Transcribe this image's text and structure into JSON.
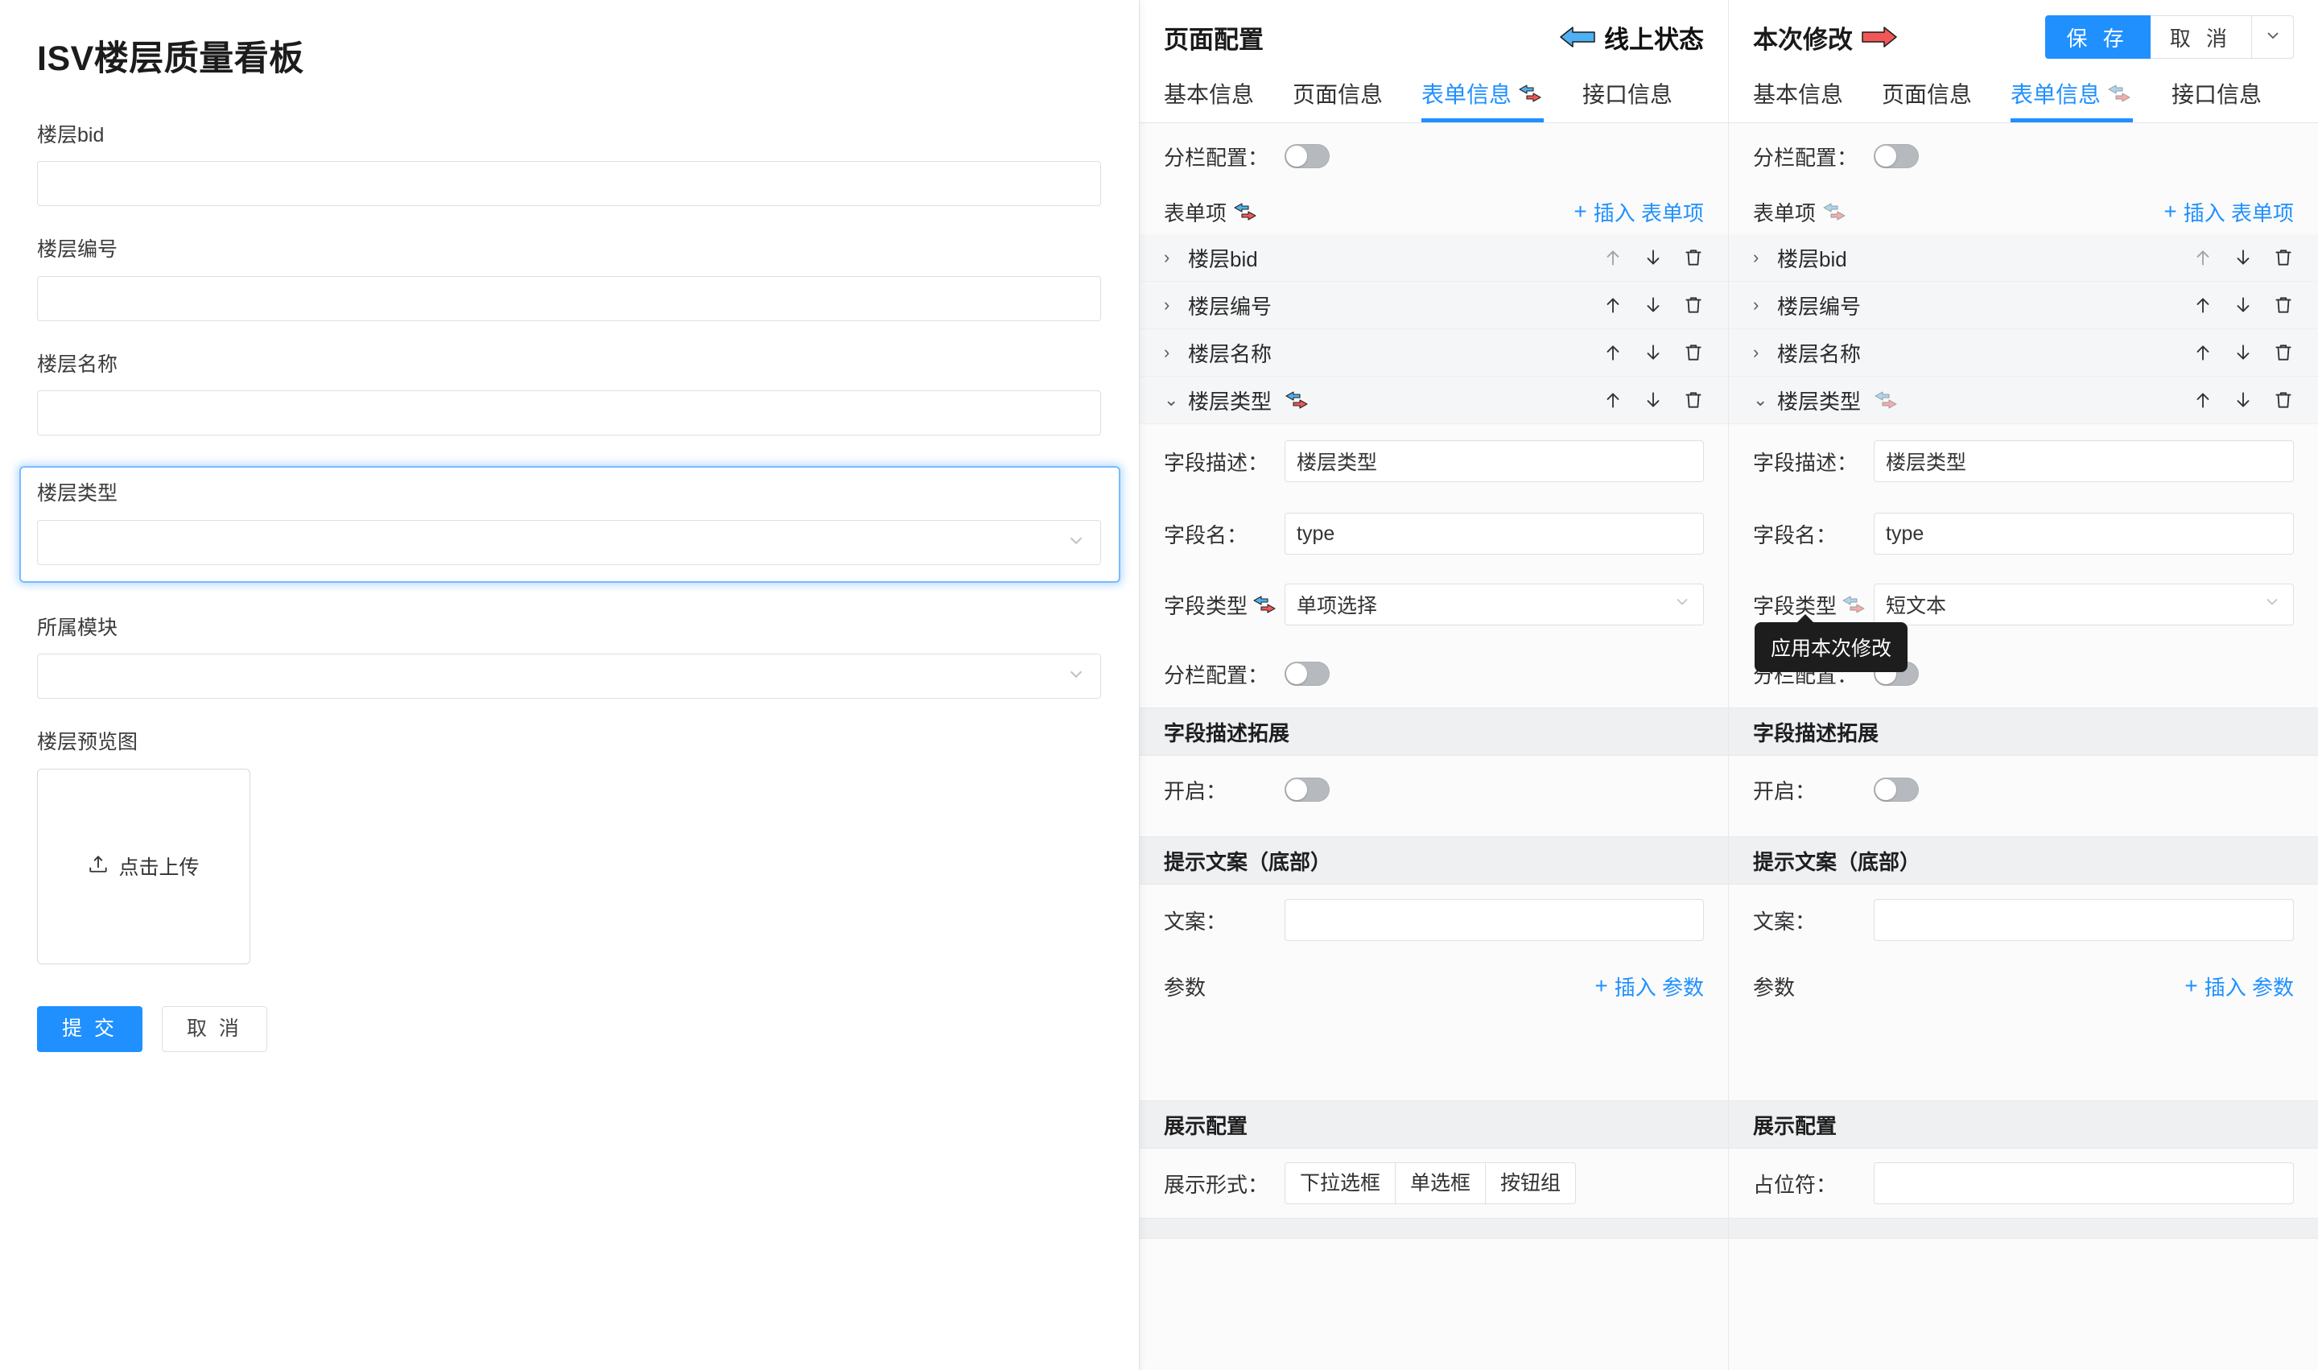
{
  "preview": {
    "title": "ISV楼层质量看板",
    "fields": [
      {
        "label": "楼层bid",
        "type": "text",
        "value": "",
        "placeholder": ""
      },
      {
        "label": "楼层编号",
        "type": "text",
        "value": "",
        "placeholder": ""
      },
      {
        "label": "楼层名称",
        "type": "text",
        "value": "",
        "placeholder": ""
      },
      {
        "label": "楼层类型",
        "type": "select",
        "value": "",
        "placeholder": "",
        "focused": true
      },
      {
        "label": "所属模块",
        "type": "select",
        "value": "",
        "placeholder": ""
      }
    ],
    "upload": {
      "label": "楼层预览图",
      "button_text": "点击上传",
      "icon": "upload-icon"
    },
    "submit_label": "提 交",
    "cancel_label": "取 消"
  },
  "middle": {
    "title": "页面配置",
    "status_badge": {
      "label": "线上状态",
      "icon": "arrow-left-blue-icon"
    },
    "tabs": [
      {
        "label": "基本信息",
        "active": false
      },
      {
        "label": "页面信息",
        "active": false
      },
      {
        "label": "表单信息",
        "active": true,
        "icon": "swap-arrows-icon"
      },
      {
        "label": "接口信息",
        "active": false
      }
    ],
    "column_config": {
      "label": "分栏配置：",
      "enabled": false
    },
    "form_items": {
      "title": "表单项",
      "title_icon": "swap-arrows-icon",
      "insert_label": "插入 表单项",
      "insert_icon": "plus-icon",
      "rows": [
        {
          "label": "楼层bid",
          "expanded": false,
          "up_disabled": true,
          "icons": [
            "arrow-up-icon",
            "arrow-down-icon",
            "trash-icon"
          ]
        },
        {
          "label": "楼层编号",
          "expanded": false,
          "up_disabled": false,
          "icons": [
            "arrow-up-icon",
            "arrow-down-icon",
            "trash-icon"
          ]
        },
        {
          "label": "楼层名称",
          "expanded": false,
          "up_disabled": false,
          "icons": [
            "arrow-up-icon",
            "arrow-down-icon",
            "trash-icon"
          ]
        },
        {
          "label": "楼层类型",
          "expanded": true,
          "up_disabled": false,
          "has_icon": true,
          "icons": [
            "arrow-up-icon",
            "arrow-down-icon",
            "trash-icon"
          ]
        }
      ]
    },
    "field_detail": {
      "desc_label": "字段描述：",
      "desc_value": "楼层类型",
      "name_label": "字段名：",
      "name_value": "type",
      "type_label": "字段类型",
      "type_icon": "swap-arrows-icon",
      "type_value": "单项选择",
      "column_label": "分栏配置：",
      "column_enabled": false
    },
    "desc_ext": {
      "title": "字段描述拓展",
      "enable_label": "开启：",
      "enabled": false
    },
    "hint_text": {
      "title": "提示文案（底部）",
      "copy_label": "文案：",
      "copy_value": ""
    },
    "params": {
      "title": "参数",
      "insert_label": "插入 参数",
      "insert_icon": "plus-icon"
    },
    "display_config": {
      "title": "展示配置",
      "form_label": "展示形式：",
      "options": [
        "下拉选框",
        "单选框",
        "按钮组"
      ]
    }
  },
  "right": {
    "title": "本次修改",
    "title_icon": "arrow-right-red-icon",
    "actions": {
      "save_label": "保 存",
      "cancel_label": "取 消",
      "dropdown_icon": "chevron-down-icon"
    },
    "tabs": [
      {
        "label": "基本信息",
        "active": false
      },
      {
        "label": "页面信息",
        "active": false
      },
      {
        "label": "表单信息",
        "active": true,
        "icon": "swap-arrows-icon"
      },
      {
        "label": "接口信息",
        "active": false
      }
    ],
    "column_config": {
      "label": "分栏配置：",
      "enabled": false
    },
    "form_items": {
      "title": "表单项",
      "title_icon": "swap-arrows-icon",
      "insert_label": "插入 表单项",
      "insert_icon": "plus-icon",
      "rows": [
        {
          "label": "楼层bid",
          "expanded": false,
          "up_disabled": true,
          "icons": [
            "arrow-up-icon",
            "arrow-down-icon",
            "trash-icon"
          ]
        },
        {
          "label": "楼层编号",
          "expanded": false,
          "up_disabled": false,
          "icons": [
            "arrow-up-icon",
            "arrow-down-icon",
            "trash-icon"
          ]
        },
        {
          "label": "楼层名称",
          "expanded": false,
          "up_disabled": false,
          "icons": [
            "arrow-up-icon",
            "arrow-down-icon",
            "trash-icon"
          ]
        },
        {
          "label": "楼层类型",
          "expanded": true,
          "up_disabled": false,
          "has_icon": true,
          "icons": [
            "arrow-up-icon",
            "arrow-down-icon",
            "trash-icon"
          ]
        }
      ]
    },
    "field_detail": {
      "desc_label": "字段描述：",
      "desc_value": "楼层类型",
      "name_label": "字段名：",
      "name_value": "type",
      "type_label": "字段类型",
      "type_icon": "swap-arrows-icon",
      "type_value": "短文本",
      "column_label": "分栏配置：",
      "column_enabled": false
    },
    "tooltip": "应用本次修改",
    "desc_ext": {
      "title": "字段描述拓展",
      "enable_label": "开启：",
      "enabled": false
    },
    "hint_text": {
      "title": "提示文案（底部）",
      "copy_label": "文案：",
      "copy_value": ""
    },
    "params": {
      "title": "参数",
      "insert_label": "插入 参数",
      "insert_icon": "plus-icon"
    },
    "display_config": {
      "title": "展示配置",
      "placeholder_label": "占位符：",
      "placeholder_value": ""
    }
  },
  "colors": {
    "accent": "#2090ff",
    "arrow_blue": "#4fb0f2",
    "arrow_red": "#f25757",
    "arrow_blue_faded": "#a8d8f4",
    "arrow_red_faded": "#f6acac",
    "toggle_off": "#b6b9bd",
    "section_bg": "#eef0f2",
    "row_bg": "#f5f6f7",
    "tooltip_bg": "#1d1d1d"
  }
}
